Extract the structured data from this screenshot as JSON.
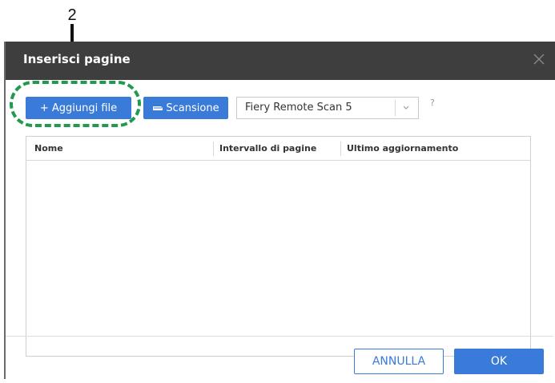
{
  "callout": {
    "number": "2"
  },
  "dialog": {
    "title": "Inserisci pagine",
    "close_icon": "close-icon"
  },
  "toolbar": {
    "add_file_label": "+ Aggiungi file",
    "scan_label": "Scansione",
    "scan_icon": "scanner-icon",
    "scanner_select_value": "Fiery Remote Scan 5",
    "help_label": "?"
  },
  "table": {
    "columns": [
      "Nome",
      "Intervallo di pagine",
      "Ultimo aggiornamento"
    ],
    "rows": []
  },
  "footer": {
    "cancel_label": "ANNULLA",
    "ok_label": "OK"
  },
  "colors": {
    "header_bg": "#3e3e3e",
    "accent": "#3a7ad8",
    "highlight": "#1f9a4e"
  }
}
